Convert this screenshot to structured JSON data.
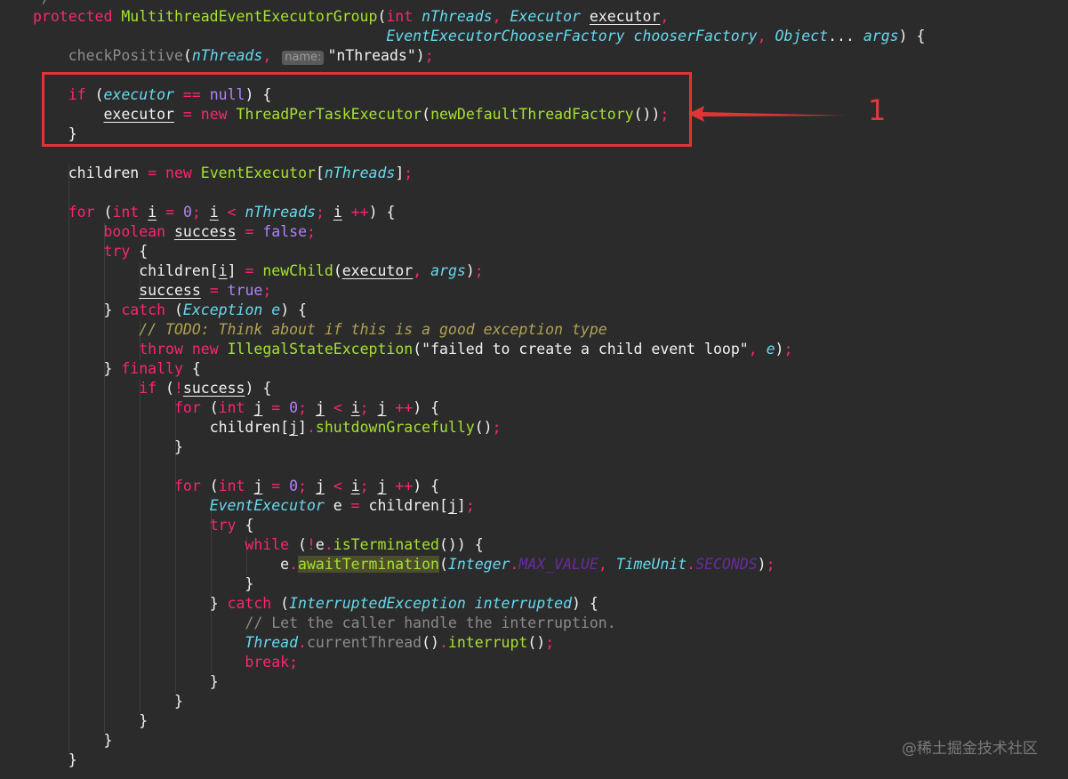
{
  "editor": {
    "partial_top": "*/",
    "annotation_number": "1",
    "watermark": "@稀土掘金技术社区"
  },
  "tokens": {
    "protected": "protected",
    "class_name": "MultithreadEventExecutorGroup",
    "int": "int",
    "nThreads": "nThreads",
    "Executor": "Executor",
    "executor": "executor",
    "EventExecutorChooserFactory": "EventExecutorChooserFactory",
    "chooserFactory": "chooserFactory",
    "Object": "Object",
    "args": "args",
    "checkPositive": "checkPositive",
    "hint_name": "name:",
    "str_nThreads": "\"nThreads\"",
    "if": "if",
    "null": "null",
    "new": "new",
    "ThreadPerTaskExecutor": "ThreadPerTaskExecutor",
    "newDefaultThreadFactory": "newDefaultThreadFactory",
    "children": "children",
    "EventExecutor": "EventExecutor",
    "for": "for",
    "i": "i",
    "zero": "0",
    "boolean": "boolean",
    "success": "success",
    "false": "false",
    "true": "true",
    "try": "try",
    "newChild": "newChild",
    "catch": "catch",
    "Exception": "Exception",
    "e": "e",
    "todo_comment": "// TODO: Think about if this is a good exception type",
    "throw": "throw",
    "IllegalStateException": "IllegalStateException",
    "str_failed": "\"failed to create a child event loop\"",
    "finally": "finally",
    "j": "j",
    "shutdownGracefully": "shutdownGracefully",
    "while": "while",
    "isTerminated": "isTerminated",
    "awaitTermination": "awaitTermination",
    "Integer": "Integer",
    "MAX_VALUE": "MAX_VALUE",
    "TimeUnit": "TimeUnit",
    "SECONDS": "SECONDS",
    "InterruptedException": "InterruptedException",
    "interrupted": "interrupted",
    "let_caller_comment": "// Let the caller handle the interruption.",
    "Thread": "Thread",
    "currentThread": "currentThread",
    "interrupt": "interrupt",
    "break": "break"
  },
  "colors": {
    "background": "#2b2b2b",
    "keyword": "#f92672",
    "function": "#a6e22e",
    "type_italic": "#66d9ef",
    "string": "#e6db74",
    "number": "#ae81ff",
    "comment": "#8a8a8a",
    "annotation_red": "#e03535"
  }
}
